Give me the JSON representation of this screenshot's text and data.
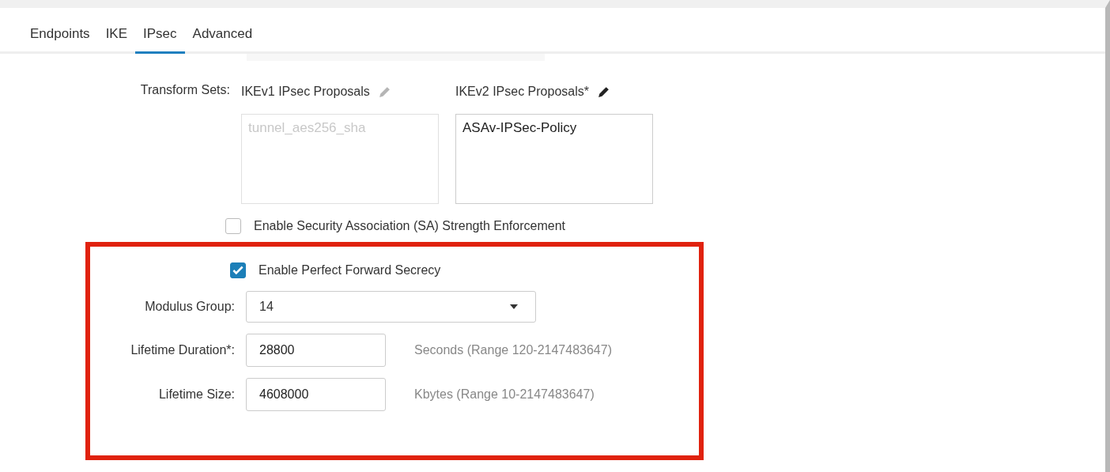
{
  "tabs": [
    {
      "label": "Endpoints",
      "selected": false
    },
    {
      "label": "IKE",
      "selected": false
    },
    {
      "label": "IPsec",
      "selected": true
    },
    {
      "label": "Advanced",
      "selected": false
    }
  ],
  "transform_sets": {
    "label": "Transform Sets:",
    "proposals": [
      {
        "title": "IKEv1 IPsec Proposals",
        "disabled": true,
        "items": [
          "tunnel_aes256_sha"
        ]
      },
      {
        "title": "IKEv2 IPsec Proposals*",
        "disabled": false,
        "items": [
          "ASAv-IPSec-Policy"
        ]
      }
    ]
  },
  "sa_strength": {
    "label": "Enable Security Association (SA) Strength Enforcement",
    "checked": false
  },
  "pfs": {
    "label": "Enable Perfect Forward Secrecy",
    "checked": true
  },
  "modulus_group": {
    "label": "Modulus Group:",
    "value": "14"
  },
  "lifetime_duration": {
    "label": "Lifetime Duration*:",
    "value": "28800",
    "hint": "Seconds (Range 120-2147483647)"
  },
  "lifetime_size": {
    "label": "Lifetime Size:",
    "value": "4608000",
    "hint": "Kbytes (Range 10-2147483647)"
  }
}
